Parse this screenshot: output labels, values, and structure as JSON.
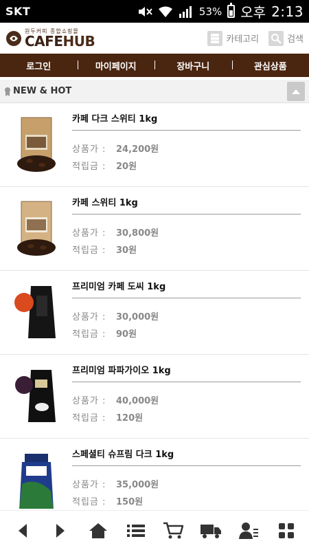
{
  "status_bar": {
    "carrier": "SKT",
    "battery_percent": "53%",
    "battery_level": 0.53,
    "ampm": "오후",
    "time": "2:13"
  },
  "header": {
    "logo_sub": "원두커피 종합쇼핑몰",
    "logo_cafe": "CAFE",
    "logo_hub": "HUB",
    "category_label": "카테고리",
    "search_label": "검색"
  },
  "nav": {
    "items": [
      {
        "label": "로그인"
      },
      {
        "label": "마이페이지"
      },
      {
        "label": "장바구니"
      },
      {
        "label": "관심상품"
      }
    ]
  },
  "section": {
    "title": "NEW & HOT"
  },
  "labels": {
    "price": "상품가 :",
    "points": "적립금 :"
  },
  "products": [
    {
      "name": "카페 다크 스위티 1kg",
      "price": "24,200원",
      "points": "20원"
    },
    {
      "name": "카페 스위티 1kg",
      "price": "30,800원",
      "points": "30원"
    },
    {
      "name": "프리미엄 카페 도씨 1kg",
      "price": "30,000원",
      "points": "90원"
    },
    {
      "name": "프리미엄 파파가이오 1kg",
      "price": "40,000원",
      "points": "120원"
    },
    {
      "name": "스페셜티 슈프림 다크 1kg",
      "price": "35,000원",
      "points": "150원"
    }
  ],
  "colors": {
    "nav_bg": "#4a2510",
    "brand": "#3b2316"
  },
  "toolbar": {
    "icons": [
      "back-icon",
      "forward-icon",
      "home-icon",
      "list-icon",
      "cart-icon",
      "delivery-truck-icon",
      "my-page-icon",
      "grid-menu-icon"
    ]
  }
}
